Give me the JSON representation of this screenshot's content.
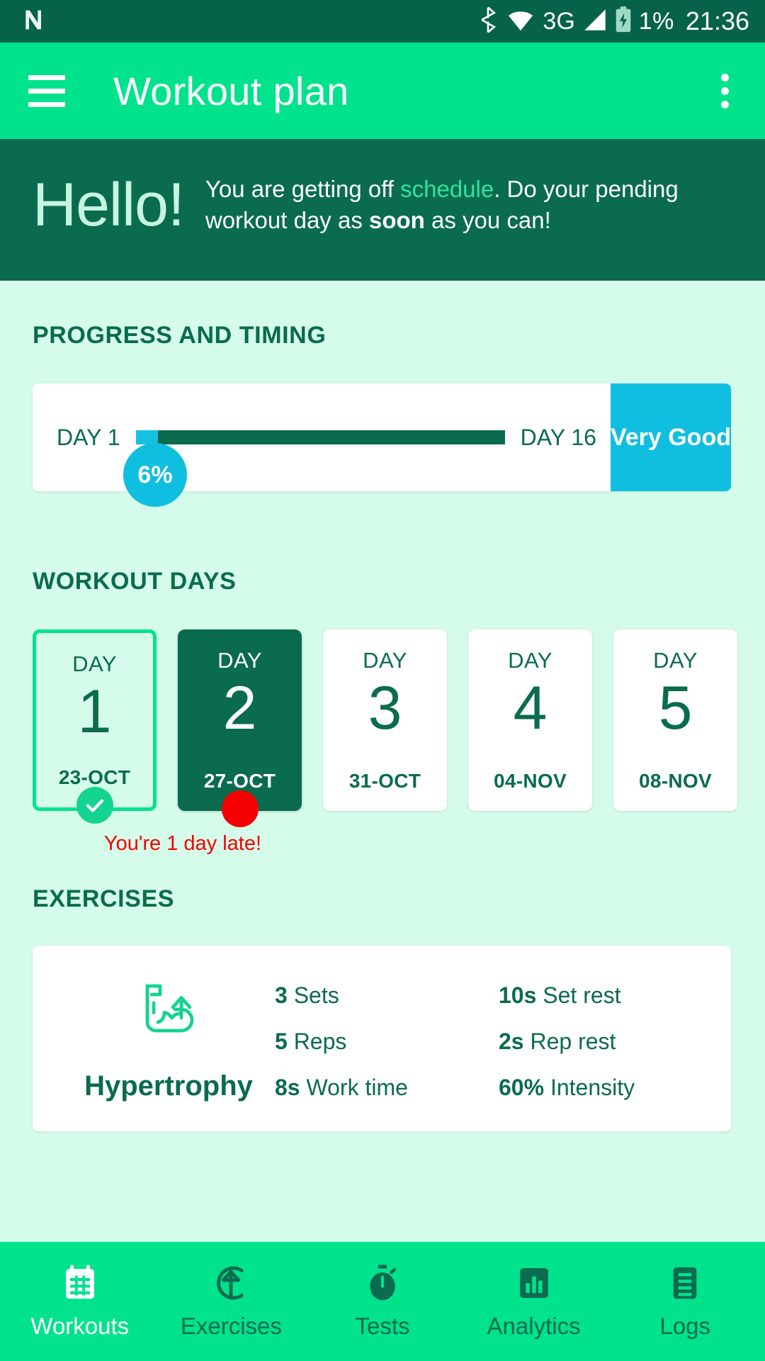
{
  "statusbar": {
    "carrier_icon": "n-logo-icon",
    "bluetooth_icon": "bluetooth-icon",
    "wifi_icon": "wifi-icon",
    "network_label": "3G",
    "signal_icon": "signal-icon",
    "battery_icon": "battery-charging-icon",
    "battery_level": "1%",
    "time": "21:36"
  },
  "appbar": {
    "menu_icon": "hamburger-menu-icon",
    "title": "Workout plan",
    "overflow_icon": "more-vertical-icon"
  },
  "hello": {
    "greeting": "Hello!",
    "message_part1": "You are getting off ",
    "highlight": "schedule",
    "message_part2": ". Do your pending workout day as ",
    "bold": "soon",
    "message_part3": " as you can!"
  },
  "progress": {
    "section_title": "PROGRESS AND TIMING",
    "start_label": "DAY 1",
    "end_label": "DAY 16",
    "percent_label": "6%",
    "percent_value": 6,
    "rating_label": "Very Good",
    "bar_fill_color": "#16c1e0",
    "bar_track_color": "#0a6b4f",
    "badge_color": "#10bfe0"
  },
  "workout_days": {
    "section_title": "WORKOUT DAYS",
    "late_note": "You're 1 day late!",
    "cards": [
      {
        "label": "DAY",
        "number": "1",
        "date": "23-OCT",
        "state": "selected",
        "marker": "check-icon"
      },
      {
        "label": "DAY",
        "number": "2",
        "date": "27-OCT",
        "state": "active",
        "marker": "red-dot-icon"
      },
      {
        "label": "DAY",
        "number": "3",
        "date": "31-OCT",
        "state": "default",
        "marker": ""
      },
      {
        "label": "DAY",
        "number": "4",
        "date": "04-NOV",
        "state": "default",
        "marker": ""
      },
      {
        "label": "DAY",
        "number": "5",
        "date": "08-NOV",
        "state": "default",
        "marker": ""
      }
    ]
  },
  "exercises": {
    "section_title": "EXERCISES",
    "card": {
      "icon": "biceps-growth-icon",
      "name": "Hypertrophy",
      "stats": [
        {
          "value": "3",
          "label": "Sets"
        },
        {
          "value": "10s",
          "label": "Set rest"
        },
        {
          "value": "5",
          "label": "Reps"
        },
        {
          "value": "2s",
          "label": "Rep rest"
        },
        {
          "value": "8s",
          "label": "Work time"
        },
        {
          "value": "60%",
          "label": "Intensity"
        }
      ]
    }
  },
  "bottomnav": {
    "items": [
      {
        "icon": "calendar-icon",
        "label": "Workouts",
        "active": true
      },
      {
        "icon": "arrow-up-circle-icon",
        "label": "Exercises",
        "active": false
      },
      {
        "icon": "stopwatch-icon",
        "label": "Tests",
        "active": false
      },
      {
        "icon": "bar-chart-icon",
        "label": "Analytics",
        "active": false
      },
      {
        "icon": "list-icon",
        "label": "Logs",
        "active": false
      }
    ]
  },
  "colors": {
    "primary": "#00e28c",
    "dark": "#0a6b4f",
    "statusbar": "#066349",
    "background": "#d5fbea",
    "accent_cyan": "#10bfe0",
    "alert_red": "#f50000"
  }
}
